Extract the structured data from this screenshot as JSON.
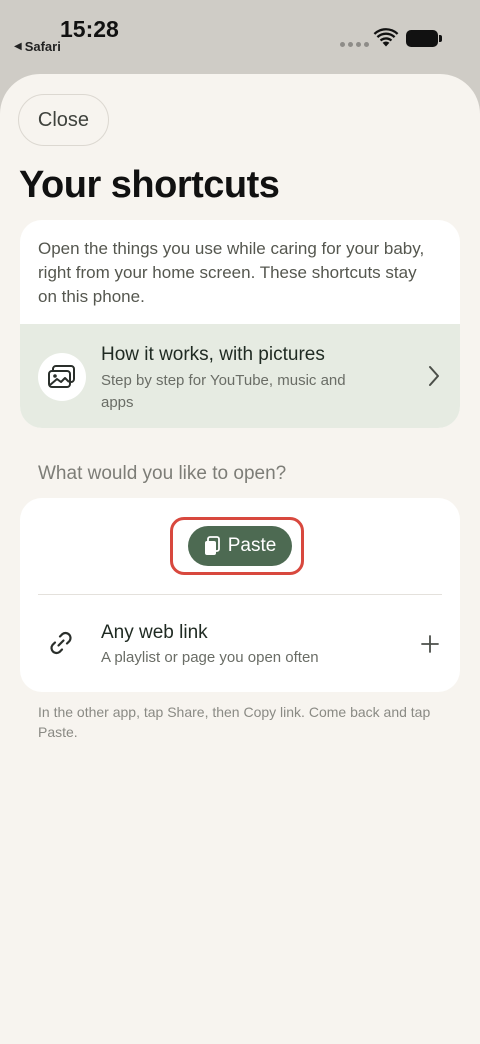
{
  "status_bar": {
    "time": "15:28",
    "back_app": "Safari",
    "icons": [
      "signal-dots-icon",
      "wifi-icon",
      "battery-icon"
    ]
  },
  "sheet": {
    "close_label": "Close",
    "title": "Your shortcuts",
    "intro": "Open the things you use while caring for your baby, right from your home screen. These shortcuts stay on this phone.",
    "how_it_works": {
      "icon": "photos-icon",
      "title": "How it works, with pictures",
      "subtitle": "Step by step for YouTube, music and apps",
      "chevron": "chevron-right-icon"
    },
    "section_label": "What would you like to open?",
    "paste": {
      "label": "Paste",
      "icon": "clipboard-icon"
    },
    "web_link": {
      "icon": "link-icon",
      "title": "Any web link",
      "subtitle": "A playlist or page you open often",
      "action_icon": "plus-icon"
    },
    "help_text": "In the other app, tap Share, then Copy link. Come back and tap Paste."
  },
  "colors": {
    "accent_green": "#4d6a52",
    "highlight_red": "#d8483e",
    "sheet_bg": "#f7f4ef",
    "how_row_bg": "#e6ebe2"
  }
}
